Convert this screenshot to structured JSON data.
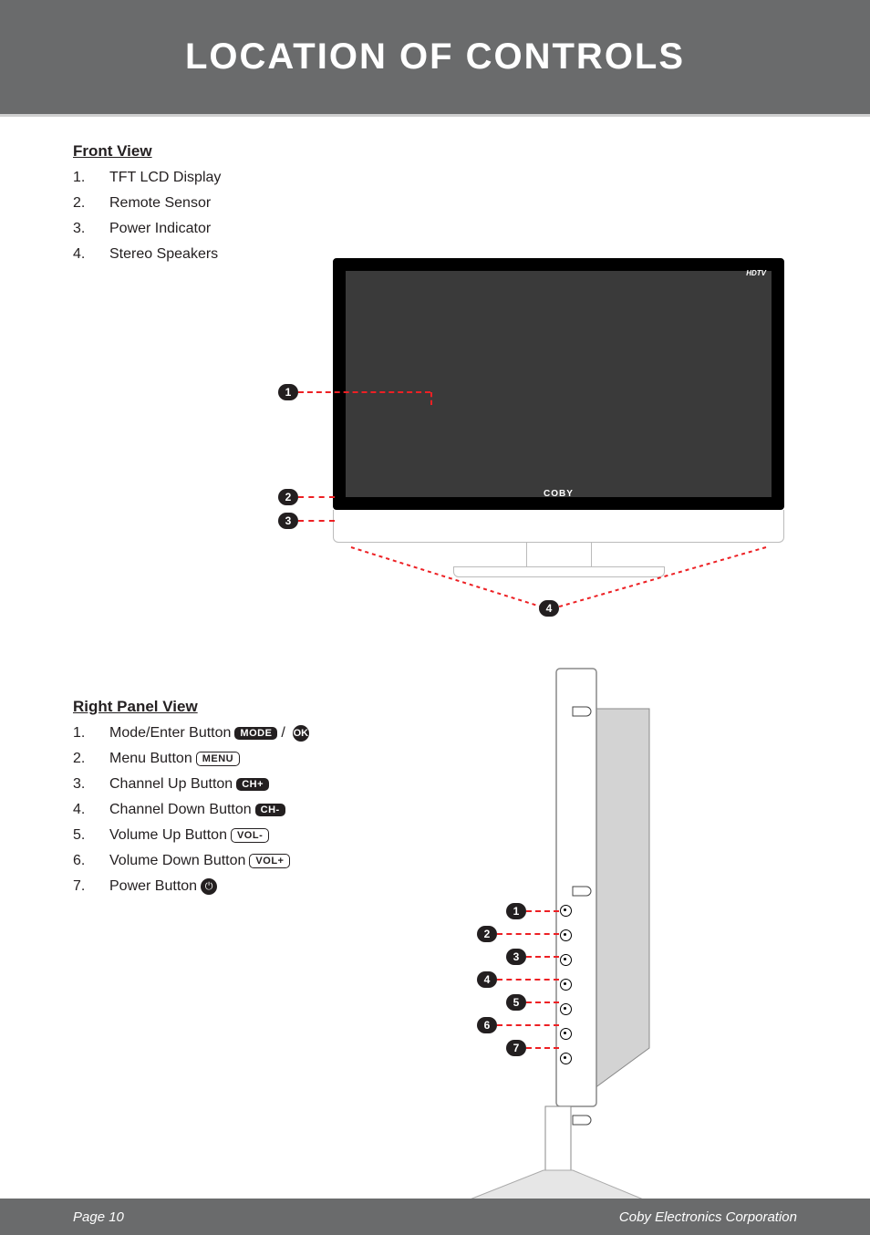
{
  "header": {
    "title": "LOCATION OF CONTROLS"
  },
  "frontView": {
    "heading": "Front View",
    "items": [
      {
        "n": "1.",
        "label": "TFT LCD Display"
      },
      {
        "n": "2.",
        "label": "Remote Sensor"
      },
      {
        "n": "3.",
        "label": "Power Indicator"
      },
      {
        "n": "4.",
        "label": "Stereo Speakers"
      }
    ]
  },
  "tvFront": {
    "brand": "COBY",
    "badge": "HDTV"
  },
  "rightPanel": {
    "heading": "Right Panel View",
    "items": [
      {
        "n": "1.",
        "label": "Mode/Enter Button",
        "pills": [
          "MODE"
        ],
        "sep": "/",
        "ok": "OK"
      },
      {
        "n": "2.",
        "label": "Menu Button",
        "pillsOutline": [
          "MENU"
        ]
      },
      {
        "n": "3.",
        "label": "Channel Up Button",
        "pills": [
          "CH+"
        ]
      },
      {
        "n": "4.",
        "label": "Channel Down Button",
        "pills": [
          "CH-"
        ]
      },
      {
        "n": "5.",
        "label": "Volume Up Button",
        "pillsOutline": [
          "VOL-"
        ]
      },
      {
        "n": "6.",
        "label": "Volume Down Button",
        "pillsOutline": [
          "VOL+"
        ]
      },
      {
        "n": "7.",
        "label": "Power Button",
        "power": "⏻"
      }
    ]
  },
  "callouts": {
    "front": {
      "1": "1",
      "2": "2",
      "3": "3",
      "4": "4"
    },
    "side": {
      "1": "1",
      "2": "2",
      "3": "3",
      "4": "4",
      "5": "5",
      "6": "6",
      "7": "7"
    }
  },
  "footer": {
    "page": "Page 10",
    "company": "Coby Electronics Corporation"
  }
}
